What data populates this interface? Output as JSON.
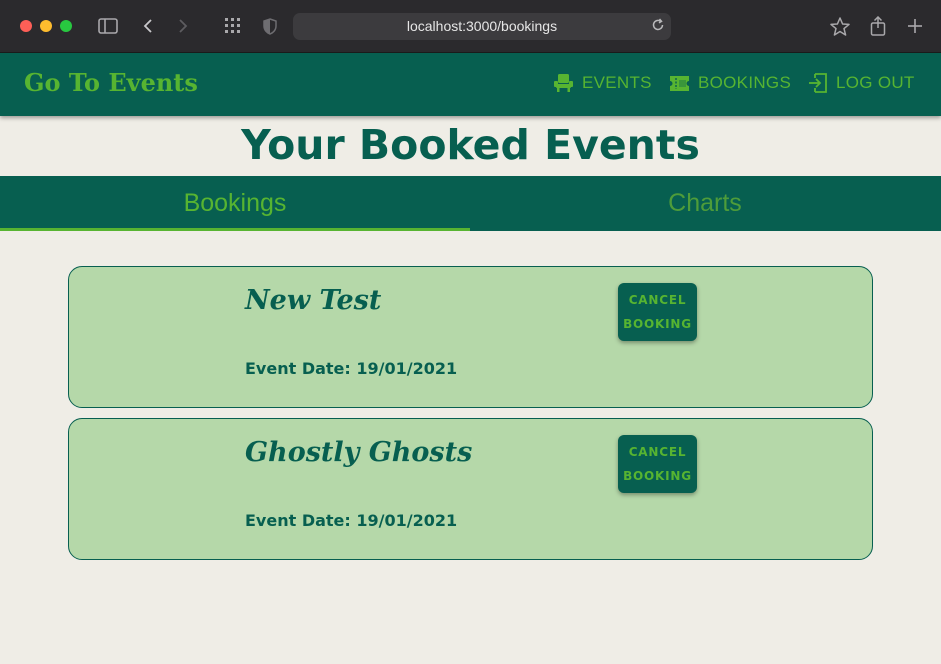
{
  "browser": {
    "url": "localhost:3000/bookings"
  },
  "app": {
    "brand": "Go To Events",
    "nav": [
      {
        "label": "EVENTS",
        "icon": "seat-icon"
      },
      {
        "label": "BOOKINGS",
        "icon": "ticket-icon"
      },
      {
        "label": "LOG OUT",
        "icon": "logout-icon"
      }
    ]
  },
  "page": {
    "title": "Your Booked Events"
  },
  "tabs": [
    {
      "label": "Bookings",
      "active": true
    },
    {
      "label": "Charts",
      "active": false
    }
  ],
  "bookings": [
    {
      "title": "New Test",
      "date": "Event Date: 19/01/2021",
      "button_line1": "CANCEL",
      "button_line2": "BOOKING"
    },
    {
      "title": "Ghostly Ghosts",
      "date": "Event Date: 19/01/2021",
      "button_line1": "CANCEL",
      "button_line2": "BOOKING"
    }
  ],
  "colors": {
    "primary": "#075f50",
    "accent": "#57b431",
    "card_bg": "#b5d8a9",
    "page_bg": "#efede6"
  }
}
